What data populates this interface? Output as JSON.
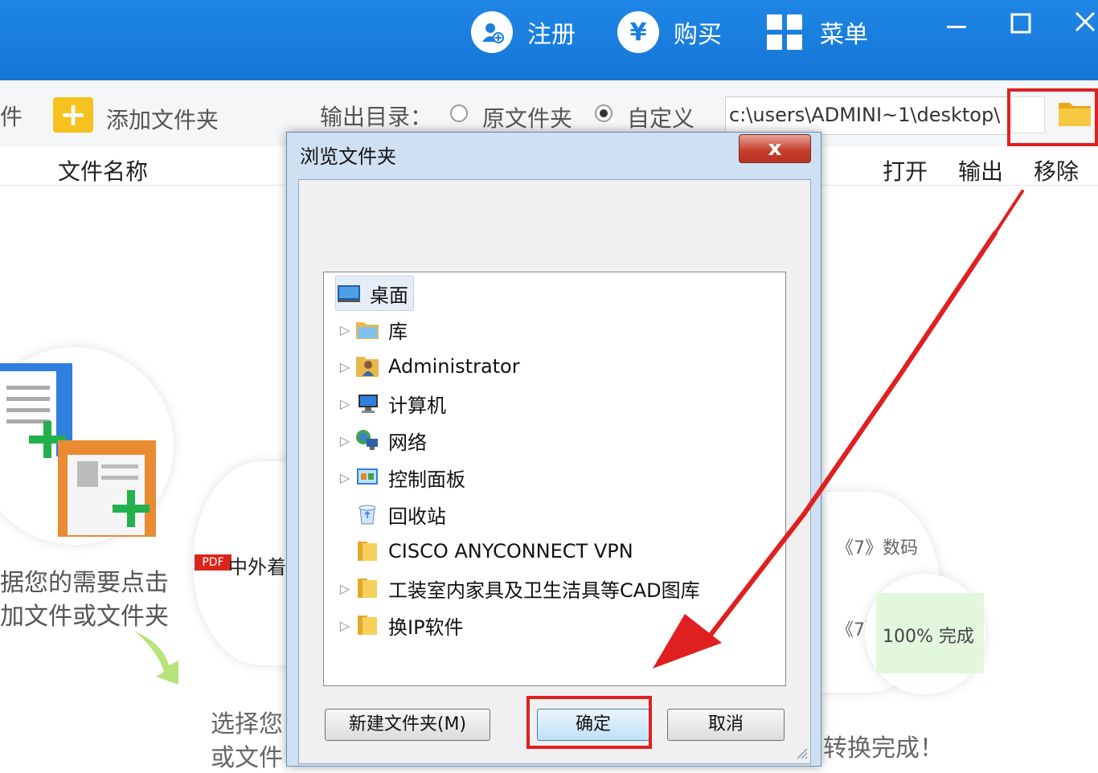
{
  "titlebar": {
    "register_label": "注册",
    "buy_label": "购买",
    "menu_label": "菜单",
    "yen_glyph": "¥"
  },
  "toolbar": {
    "add_file_partial": "件",
    "add_folder_label": "添加文件夹",
    "output_dir_label": "输出目录：",
    "option_original": "原文件夹",
    "option_custom": "自定义",
    "selected_option": "自定义",
    "output_path": "c:\\users\\ADMINI~1\\desktop\\"
  },
  "columns": {
    "file_name": "文件名称",
    "open": "打开",
    "output": "输出",
    "remove": "移除"
  },
  "background": {
    "step1_line1": "据您的需要点击",
    "step1_line2": "加文件或文件夹",
    "step2_line1": "选择您",
    "step2_line2": "或文件",
    "step2_file": "中外着",
    "pdf_badge": "PDF",
    "step3_item1": "《7》数码",
    "step3_item2": "《7》",
    "progress_text": "100%  完成",
    "step3_done": "转换完成！"
  },
  "dialog": {
    "title": "浏览文件夹",
    "close_glyph": "x",
    "tree": [
      {
        "label": "桌面",
        "icon": "desktop-icon",
        "expandable": false,
        "selected": true
      },
      {
        "label": "库",
        "icon": "library-icon",
        "expandable": true
      },
      {
        "label": "Administrator",
        "icon": "user-folder-icon",
        "expandable": true
      },
      {
        "label": "计算机",
        "icon": "computer-icon",
        "expandable": true
      },
      {
        "label": "网络",
        "icon": "network-icon",
        "expandable": true
      },
      {
        "label": "控制面板",
        "icon": "control-panel-icon",
        "expandable": true
      },
      {
        "label": "回收站",
        "icon": "recycle-bin-icon",
        "expandable": false
      },
      {
        "label": "CISCO ANYCONNECT VPN",
        "icon": "folder-icon",
        "expandable": false
      },
      {
        "label": "工装室内家具及卫生洁具等CAD图库",
        "icon": "folder-icon",
        "expandable": true
      },
      {
        "label": "换IP软件",
        "icon": "folder-icon",
        "expandable": true
      }
    ],
    "new_folder_button": "新建文件夹(M)",
    "ok_button": "确定",
    "cancel_button": "取消"
  },
  "colors": {
    "titlebar": "#1a7fe0",
    "annotation_red": "#e02020",
    "folder_yellow": "#f5c21f"
  }
}
